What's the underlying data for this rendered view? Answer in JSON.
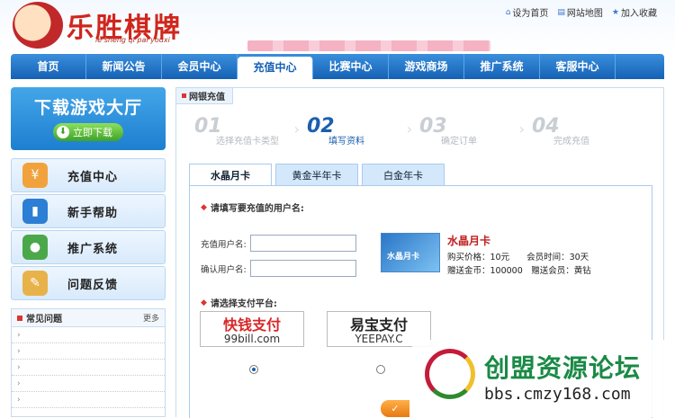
{
  "header": {
    "logo_text": "乐胜棋牌",
    "logo_pinyin": "le sheng qi pai youxi",
    "toplinks": [
      {
        "icon": "home-icon",
        "label": "设为首页"
      },
      {
        "icon": "sitemap-icon",
        "label": "网站地图"
      },
      {
        "icon": "star-icon",
        "label": "加入收藏"
      }
    ]
  },
  "nav": [
    "首页",
    "新闻公告",
    "会员中心",
    "充值中心",
    "比赛中心",
    "游戏商场",
    "推广系统",
    "客服中心"
  ],
  "sidebar": {
    "download_title": "下载游戏大厅",
    "download_button": "立即下载",
    "menu": [
      {
        "label": "充值中心",
        "icon": "coin-hand-icon",
        "color": "#f2a23c"
      },
      {
        "label": "新手帮助",
        "icon": "book-icon",
        "color": "#2c7fd4"
      },
      {
        "label": "推广系统",
        "icon": "user-globe-icon",
        "color": "#4aa84a"
      },
      {
        "label": "问题反馈",
        "icon": "note-icon",
        "color": "#e8b24a"
      }
    ],
    "faq_title": "常见问题",
    "faq_more": "更多",
    "faq_rows": [
      "›",
      "›",
      "›",
      "›",
      "›"
    ]
  },
  "main": {
    "tab_label": "网银充值",
    "steps": [
      {
        "num": "01",
        "label": "选择充值卡类型"
      },
      {
        "num": "02",
        "label": "填写资料"
      },
      {
        "num": "03",
        "label": "确定订单"
      },
      {
        "num": "04",
        "label": "完成充值"
      }
    ],
    "card_tabs": [
      "水晶月卡",
      "黄金半年卡",
      "白金年卡"
    ],
    "section_user": "请填写要充值的用户名:",
    "field_user_label": "充值用户名:",
    "field_confirm_label": "确认用户名:",
    "field_user_value": "",
    "field_confirm_value": "",
    "product": {
      "image_text": "水晶月卡",
      "name": "水晶月卡",
      "line1": "购买价格：10元　　会员时间：30天",
      "line2": "赠送金币：100000　赠送会员：黄钻"
    },
    "section_pay": "请选择支付平台:",
    "pay_options": [
      {
        "name": "快钱支付",
        "sub": "99bill.com",
        "name_color": "#d8282a"
      },
      {
        "name": "易宝支付",
        "sub": "YEEPAY.C",
        "name_color": "#222222"
      }
    ]
  },
  "watermark": {
    "cn": "创盟资源论坛",
    "url": "bbs.cmzy168.com"
  }
}
